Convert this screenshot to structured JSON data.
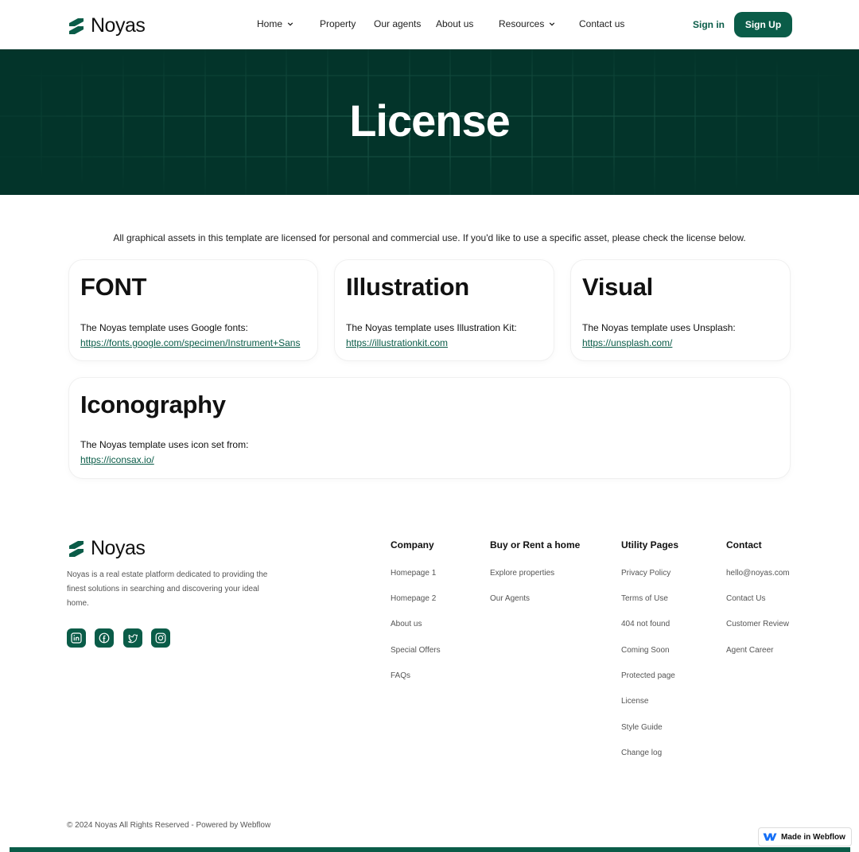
{
  "brand": {
    "name": "Noyas",
    "accent": "#0a5c48",
    "hero_bg": "#03342a"
  },
  "nav": {
    "items": [
      {
        "label": "Home",
        "dropdown": true
      },
      {
        "label": "Property",
        "dropdown": false
      },
      {
        "label": "Our agents",
        "dropdown": false
      },
      {
        "label": "About us",
        "dropdown": false
      },
      {
        "label": "Resources",
        "dropdown": true
      },
      {
        "label": "Contact us",
        "dropdown": false
      }
    ],
    "signin": "Sign in",
    "signup": "Sign Up"
  },
  "hero": {
    "title": "License"
  },
  "intro": "All graphical assets in this template are licensed for personal and commercial use. If you'd like to use a specific asset, please check the license below.",
  "cards": [
    {
      "title": "FONT",
      "text": "The Noyas template uses Google fonts:",
      "link": "https://fonts.google.com/specimen/Instrument+Sans"
    },
    {
      "title": "Illustration",
      "text": "The Noyas template uses Illustration Kit:",
      "link": "https://illustrationkit.com"
    },
    {
      "title": "Visual",
      "text": "The Noyas template uses Unsplash:",
      "link": "https://unsplash.com/"
    },
    {
      "title": "Iconography",
      "text": "The Noyas template uses icon set from:",
      "link": "https://iconsax.io/"
    }
  ],
  "footer": {
    "description": "Noyas is a real estate platform dedicated to providing the finest solutions in searching and discovering your ideal home.",
    "social": [
      "linkedin-icon",
      "facebook-icon",
      "twitter-icon",
      "instagram-icon"
    ],
    "columns": [
      {
        "heading": "Company",
        "links": [
          "Homepage 1",
          "Homepage 2",
          "About us",
          "Special Offers",
          "FAQs"
        ]
      },
      {
        "heading": "Buy or Rent a home",
        "links": [
          "Explore properties",
          "Our Agents"
        ]
      },
      {
        "heading": "Utility Pages",
        "links": [
          "Privacy Policy",
          "Terms of Use",
          "404 not found",
          "Coming Soon",
          "Protected page",
          "License",
          "Style Guide",
          "Change log"
        ]
      },
      {
        "heading": "Contact",
        "links": [
          "hello@noyas.com",
          "Contact Us",
          "Customer Review",
          "Agent Career"
        ]
      }
    ],
    "copyright": "© 2024 Noyas All Rights Reserved - Powered by Webflow"
  },
  "badge": {
    "label": "Made in Webflow"
  }
}
